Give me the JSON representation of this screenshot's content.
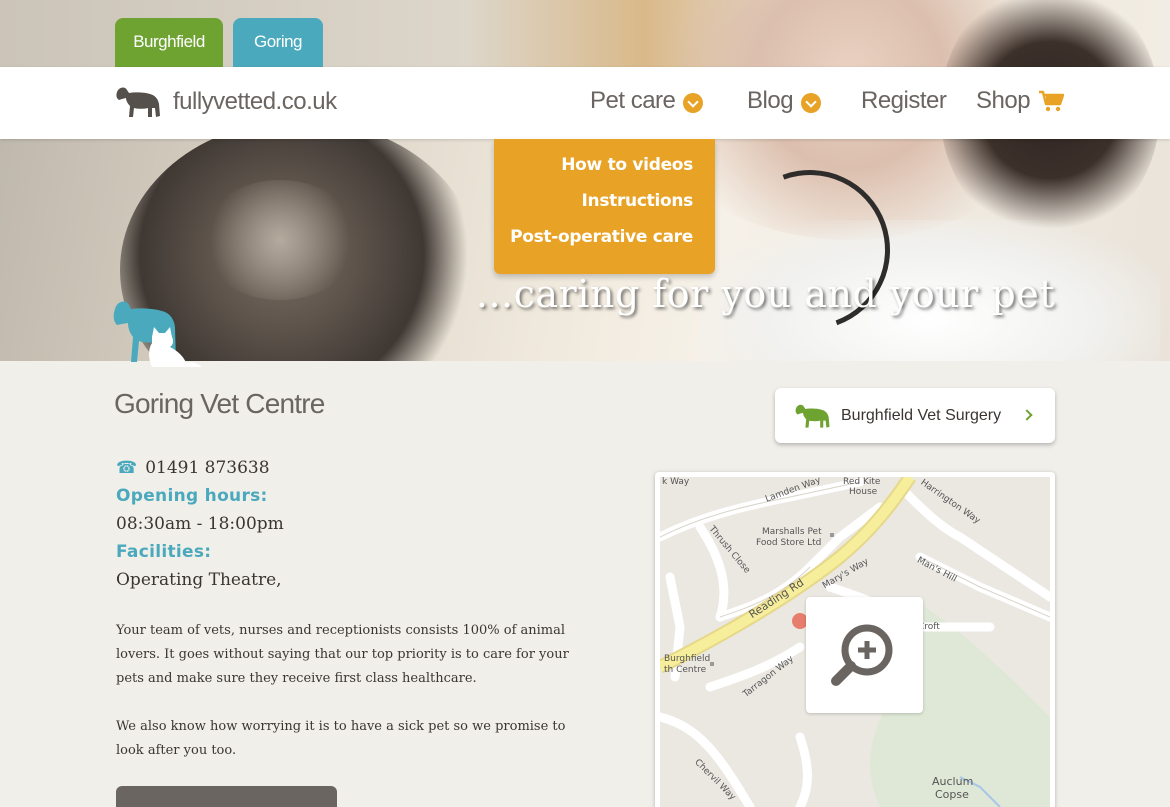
{
  "location_tabs": {
    "burghfield": "Burghfield",
    "goring": "Goring"
  },
  "logo": {
    "text": "fullyvetted.co.uk"
  },
  "nav": {
    "pet_care": "Pet care",
    "blog": "Blog",
    "register": "Register",
    "shop": "Shop"
  },
  "dropdown": {
    "items": [
      "How to videos",
      "Instructions",
      "Post-operative care"
    ]
  },
  "hero": {
    "tagline": "...caring for you and your pet"
  },
  "page": {
    "title": "Goring Vet Centre",
    "phone": "01491 873638",
    "opening_hours_label": "Opening hours:",
    "opening_hours": "08:30am - 18:00pm",
    "facilities_label": "Facilities:",
    "facilities": "Operating Theatre,",
    "paragraph1": "Your team of vets, nurses and receptionists consists 100% of animal lovers.  It goes without saying that our top priority is to care for your pets and make sure they receive first class healthcare.",
    "paragraph2": "We also know how worrying it is to have a sick pet so we promise to look after you too."
  },
  "other_surgery": {
    "label": "Burghfield Vet Surgery"
  },
  "map": {
    "labels": {
      "lamden_way": "Lamden Way",
      "red_kite": "Red Kite",
      "house": "House",
      "harrington_way": "Harrington Way",
      "marshalls_1": "Marshalls Pet",
      "marshalls_2": "Food Store Ltd",
      "thrush_close": "Thrush Close",
      "reading_rd": "Reading Rd",
      "marys_way": "Mary's Way",
      "mans_hill": "Man's Hill",
      "croft": "Croft",
      "burghfield_1": "Burghfield",
      "burghfield_2": "th Centre",
      "tarragon_way": "Tarragon Way",
      "chervil_way": "Chervil Way",
      "auclum_1": "Auclum",
      "auclum_2": "Copse"
    }
  },
  "colors": {
    "green": "#6ea332",
    "teal": "#4aa9bc",
    "orange": "#e8a327",
    "text_grey": "#6a6560"
  }
}
